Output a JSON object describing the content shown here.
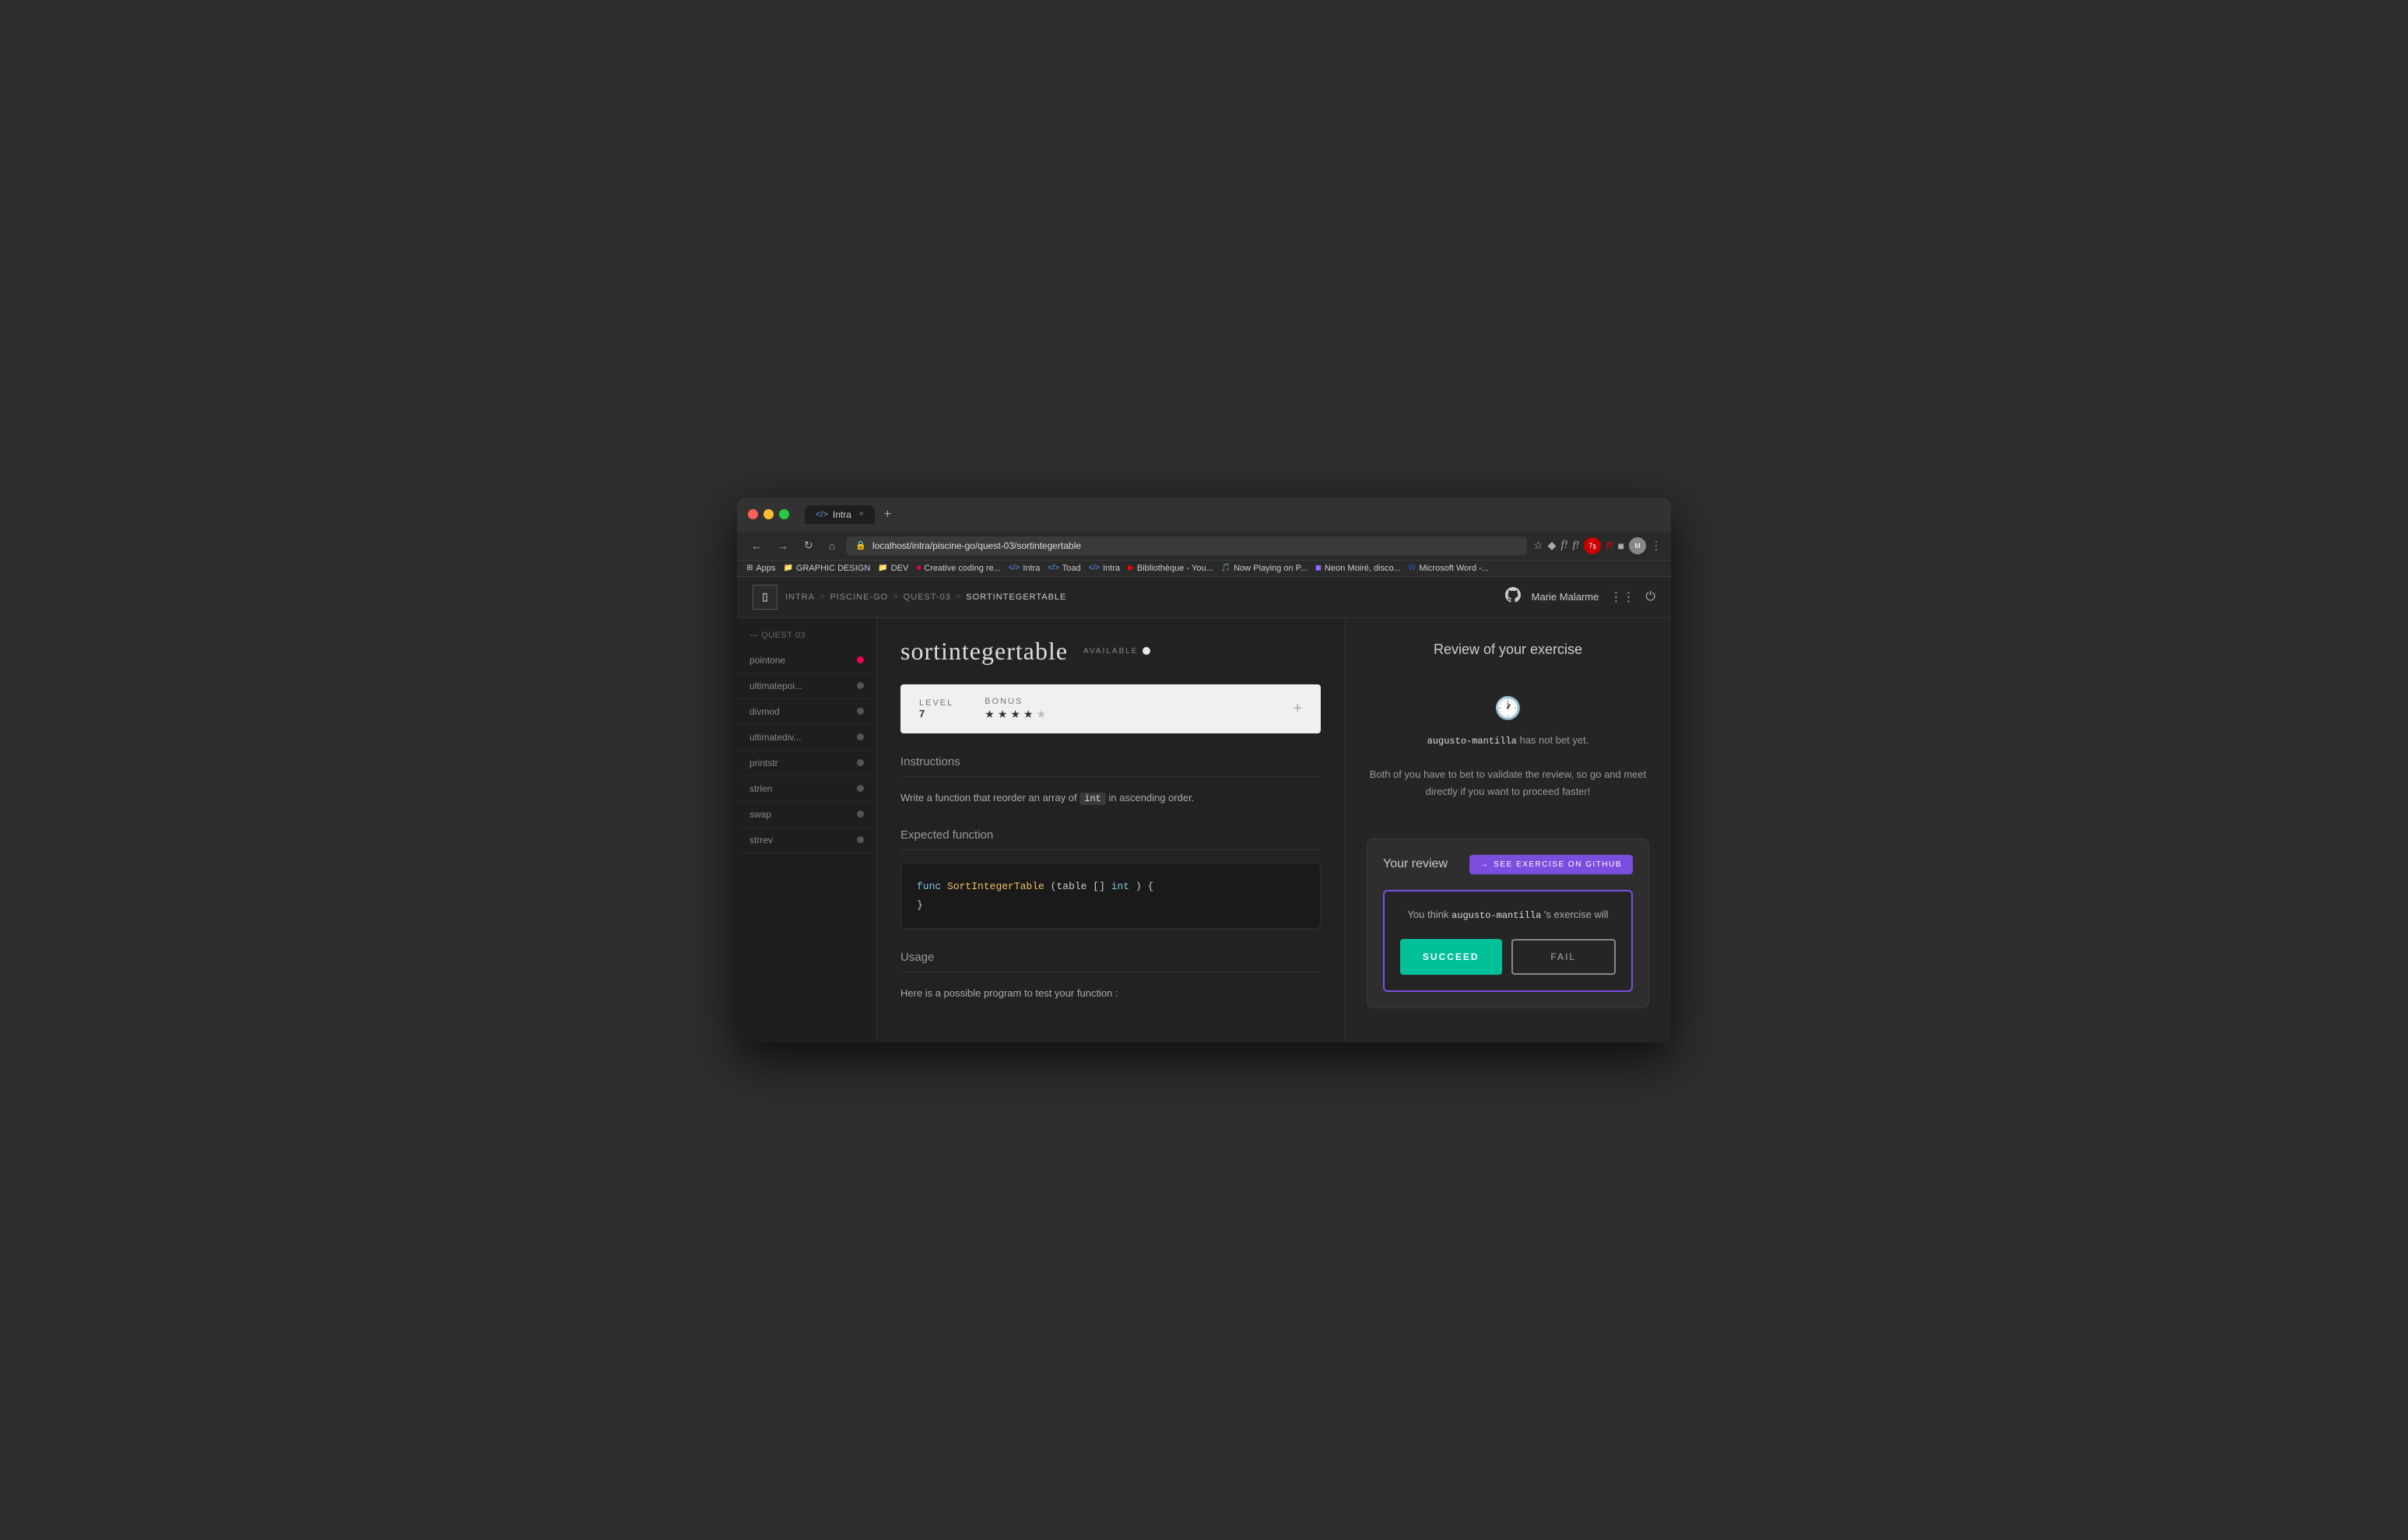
{
  "browser": {
    "tab_title": "Intra",
    "tab_icon": "</>",
    "url": "localhost/intra/piscine-go/quest-03/sortintegertable",
    "new_tab_label": "+",
    "close_label": "×"
  },
  "bookmarks": [
    {
      "id": "apps",
      "icon": "⊞",
      "label": "Apps",
      "color": "blue"
    },
    {
      "id": "graphic-design",
      "icon": "📁",
      "label": "GRAPHIC DESIGN",
      "color": "default"
    },
    {
      "id": "dev",
      "icon": "📁",
      "label": "DEV",
      "color": "default"
    },
    {
      "id": "creative-coding",
      "icon": "◉",
      "label": "Creative coding re...",
      "color": "red"
    },
    {
      "id": "intra1",
      "icon": "</>",
      "label": "Intra",
      "color": "blue"
    },
    {
      "id": "toad",
      "icon": "</>",
      "label": "Toad",
      "color": "blue"
    },
    {
      "id": "intra2",
      "icon": "</>",
      "label": "Intra",
      "color": "blue"
    },
    {
      "id": "bibliotheque",
      "icon": "▶",
      "label": "Bibliothèque - You...",
      "color": "yt"
    },
    {
      "id": "now-playing",
      "icon": "🎵",
      "label": "Now Playing on P...",
      "color": "default"
    },
    {
      "id": "neon-moire",
      "icon": "◼",
      "label": "Neon Moiré, disco...",
      "color": "purple"
    },
    {
      "id": "microsoft-word",
      "icon": "W",
      "label": "Microsoft Word -...",
      "color": "blue"
    }
  ],
  "app_header": {
    "logo": "▣",
    "breadcrumb": [
      "INTRA",
      "PISCINE-GO",
      "QUEST-03",
      "SORTINTEGERTABLE"
    ],
    "user_name": "Marie Malarme"
  },
  "sidebar": {
    "section_title": "— QUEST 03",
    "items": [
      {
        "label": "pointone",
        "dot_type": "red"
      },
      {
        "label": "ultimatepoi...",
        "dot_type": "gray"
      },
      {
        "label": "divmod",
        "dot_type": "gray"
      },
      {
        "label": "ultimatediv...",
        "dot_type": "gray"
      },
      {
        "label": "printstr",
        "dot_type": "gray"
      },
      {
        "label": "strlen",
        "dot_type": "gray"
      },
      {
        "label": "swap",
        "dot_type": "gray"
      },
      {
        "label": "strrev",
        "dot_type": "gray"
      }
    ]
  },
  "exercise": {
    "name": "sortintegertable",
    "status": "AVAILABLE",
    "level_label": "LEVEL",
    "level_value": "7",
    "bonus_label": "BONUS",
    "stars_filled": 4,
    "stars_total": 5,
    "plus_label": "+",
    "instructions_title": "Instructions",
    "instruction_text": "Write a function that reorder an array of",
    "instruction_inline_code": "int",
    "instruction_suffix": "in ascending order.",
    "expected_fn_title": "Expected function",
    "code_lines": [
      {
        "tokens": [
          {
            "type": "keyword",
            "text": "func"
          },
          {
            "type": "space",
            "text": " "
          },
          {
            "type": "fn-name",
            "text": "SortIntegerTable"
          },
          {
            "type": "paren",
            "text": "(table []"
          },
          {
            "type": "type",
            "text": "int"
          },
          {
            "type": "paren",
            "text": ") {"
          }
        ]
      },
      {
        "tokens": [
          {
            "type": "brace",
            "text": "}"
          }
        ]
      }
    ],
    "usage_title": "Usage",
    "usage_text": "Here is a possible program to test your function :"
  },
  "review": {
    "title": "Review of your exercise",
    "waiting_username": "augusto-mantilla",
    "waiting_text1": " has not bet yet.",
    "waiting_text2": "Both of you have to bet to validate the review, so go and meet directly if you want to proceed faster!",
    "your_review_title": "Your review",
    "github_btn_arrow": "→",
    "github_btn_label": "SEE EXERCISE ON GITHUB",
    "review_box_text_pre": "You think ",
    "review_box_username": "augusto-mantilla",
    "review_box_text_post": "'s exercise will",
    "succeed_label": "SUCCEED",
    "fail_label": "FAIL"
  }
}
